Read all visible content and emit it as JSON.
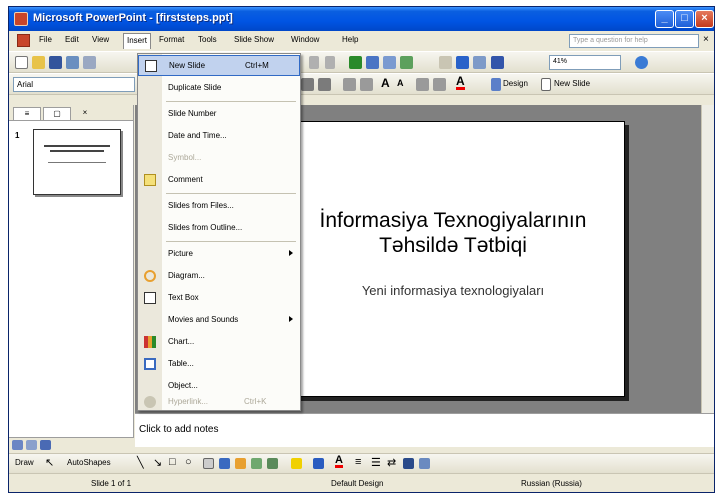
{
  "window": {
    "title": "Microsoft PowerPoint - [firststeps.ppt]"
  },
  "menubar": {
    "items": [
      "File",
      "Edit",
      "View",
      "Insert",
      "Format",
      "Tools",
      "Slide Show",
      "Window",
      "Help"
    ],
    "help_placeholder": "Type a question for help"
  },
  "formatting": {
    "font": "Arial",
    "zoom": "41%",
    "design_label": "Design",
    "new_slide_label": "New Slide"
  },
  "insert_menu": {
    "items": [
      {
        "label": "New Slide",
        "shortcut": "Ctrl+M",
        "icon": "new-slide-icon"
      },
      {
        "label": "Duplicate Slide"
      },
      {
        "label": "Slide Number"
      },
      {
        "label": "Date and Time..."
      },
      {
        "label": "Symbol..."
      },
      {
        "label": "Comment",
        "icon": "comment-icon"
      },
      {
        "label": "Slides from Files..."
      },
      {
        "label": "Slides from Outline..."
      },
      {
        "label": "Picture"
      },
      {
        "label": "Diagram...",
        "icon": "diagram-icon"
      },
      {
        "label": "Text Box",
        "icon": "text-box-icon"
      },
      {
        "label": "Movies and Sounds"
      },
      {
        "label": "Chart...",
        "icon": "chart-icon"
      },
      {
        "label": "Table...",
        "icon": "table-icon"
      },
      {
        "label": "Object..."
      },
      {
        "label": "Hyperlink...",
        "shortcut": "Ctrl+K",
        "icon": "hyperlink-icon"
      }
    ]
  },
  "slides_panel": {
    "slide_number": "1"
  },
  "slide": {
    "title_line1": "İnformasiya Texnogiyalarının",
    "title_line2": "Təhsildə Tətbiqi",
    "subtitle": "Yeni informasiya texnologiyaları"
  },
  "notes": {
    "placeholder": "Click to add notes"
  },
  "drawing": {
    "draw_label": "Draw",
    "autoshapes_label": "AutoShapes"
  },
  "status": {
    "slide": "Slide 1 of 1",
    "design": "Default Design",
    "language": "Russian (Russia)"
  }
}
